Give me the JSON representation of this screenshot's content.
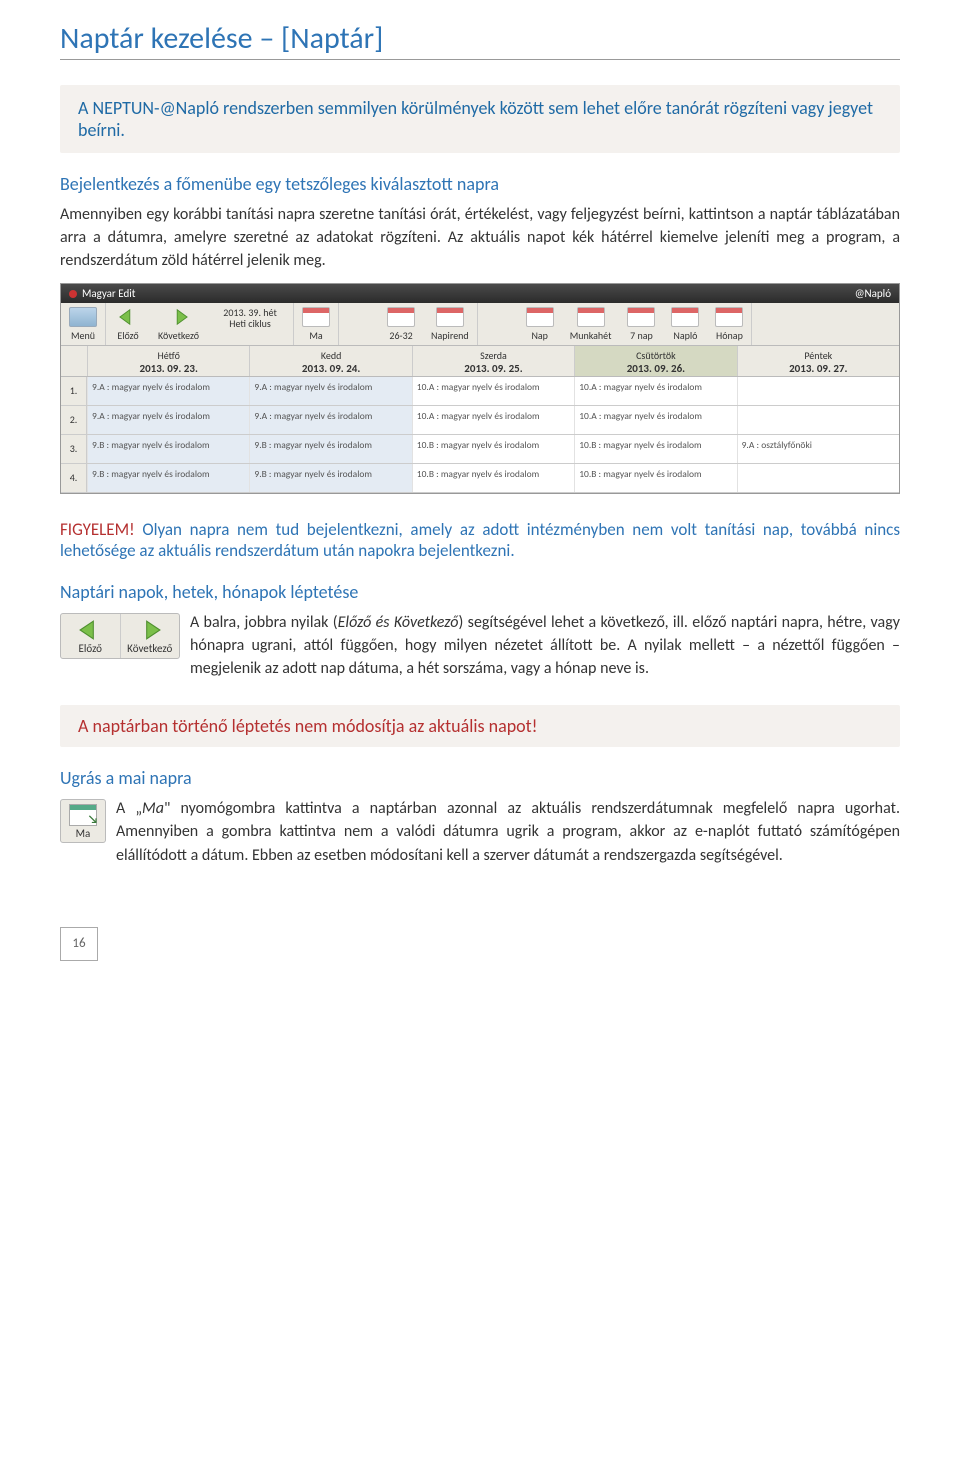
{
  "title": "Naptár kezelése – [Naptár]",
  "highlight1": "A NEPTUN-@Napló rendszerben semmilyen körülmények között sem lehet előre tanórát rögzíteni vagy jegyet beírni.",
  "sub1": "Bejelentkezés a főmenübe egy tetszőleges kiválasztott napra",
  "para1": "Amennyiben egy korábbi tanítási napra szeretne tanítási órát, értékelést, vagy feljegyzést beírni, kattintson a naptár táblázatában arra a dátumra, amelyre szeretné az adatokat rögzíteni. Az aktuális napot kék hátérrel kiemelve jeleníti meg a program, a rendszerdátum zöld hátérrel jelenik meg.",
  "app": {
    "user": "Magyar Edit",
    "brand": "@Napló",
    "toolbar": {
      "menu": "Menü",
      "prev": "Előző",
      "next": "Következő",
      "week_top": "2013. 39. hét",
      "week_bottom": "Heti ciklus",
      "ma": "Ma",
      "range": "26-32",
      "napirend": "Napirend",
      "nap": "Nap",
      "munkahet": "Munkahét",
      "nap7": "7 nap",
      "naplo": "Napló",
      "honap": "Hónap"
    },
    "days": [
      {
        "name": "Hétfő",
        "date": "2013. 09. 23."
      },
      {
        "name": "Kedd",
        "date": "2013. 09. 24."
      },
      {
        "name": "Szerda",
        "date": "2013. 09. 25."
      },
      {
        "name": "Csütörtök",
        "date": "2013. 09. 26."
      },
      {
        "name": "Péntek",
        "date": "2013. 09. 27."
      }
    ],
    "rows": [
      {
        "n": "1.",
        "cells": [
          "9.A : magyar nyelv és irodalom",
          "9.A : magyar nyelv és irodalom",
          "10.A : magyar nyelv és irodalom",
          "10.A : magyar nyelv és irodalom",
          ""
        ]
      },
      {
        "n": "2.",
        "cells": [
          "9.A : magyar nyelv és irodalom",
          "9.A : magyar nyelv és irodalom",
          "10.A : magyar nyelv és irodalom",
          "10.A : magyar nyelv és irodalom",
          ""
        ]
      },
      {
        "n": "3.",
        "cells": [
          "9.B : magyar nyelv és irodalom",
          "9.B : magyar nyelv és irodalom",
          "10.B : magyar nyelv és irodalom",
          "10.B : magyar nyelv és irodalom",
          "9.A : osztályfőnöki"
        ]
      },
      {
        "n": "4.",
        "cells": [
          "9.B : magyar nyelv és irodalom",
          "9.B : magyar nyelv és irodalom",
          "10.B : magyar nyelv és irodalom",
          "10.B : magyar nyelv és irodalom",
          ""
        ]
      }
    ]
  },
  "warning_lead": "FIGYELEM!",
  "warning_body": " Olyan napra nem tud bejelentkezni, amely az adott intézményben nem volt tanítási nap, továbbá nincs lehetősége az aktuális rendszerdátum után napokra bejelentkezni.",
  "sub2": "Naptári napok, hetek, hónapok léptetése",
  "nav_prev": "Előző",
  "nav_next": "Következő",
  "para2a": "A balra, jobbra nyilak (",
  "para2b_italic": "Előző és Következő",
  "para2c": ") segítségével lehet a következő, ill. előző naptári napra, hétre, vagy hónapra ugrani, attól függően, hogy milyen nézetet állított be. A nyilak mellett – a nézettől függően – megjelenik az adott nap dátuma, a hét sorszáma, vagy a hónap neve is.",
  "red_note": "A naptárban történő léptetés nem módosítja az aktuális napot!",
  "sub3": "Ugrás a mai napra",
  "ma_label": "Ma",
  "para3a": "A „",
  "para3b_italic": "Ma",
  "para3c": "\" nyomógombra kattintva a naptárban azonnal az aktuális rendszerdátumnak megfelelő napra ugorhat. Amennyiben a gombra kattintva nem a valódi dátumra ugrik a program, akkor az e-naplót futtató számítógépen elállítódott a dátum. Ebben az esetben módosítani kell a szerver dátumát a rendszergazda segítségével.",
  "page_number": "16"
}
